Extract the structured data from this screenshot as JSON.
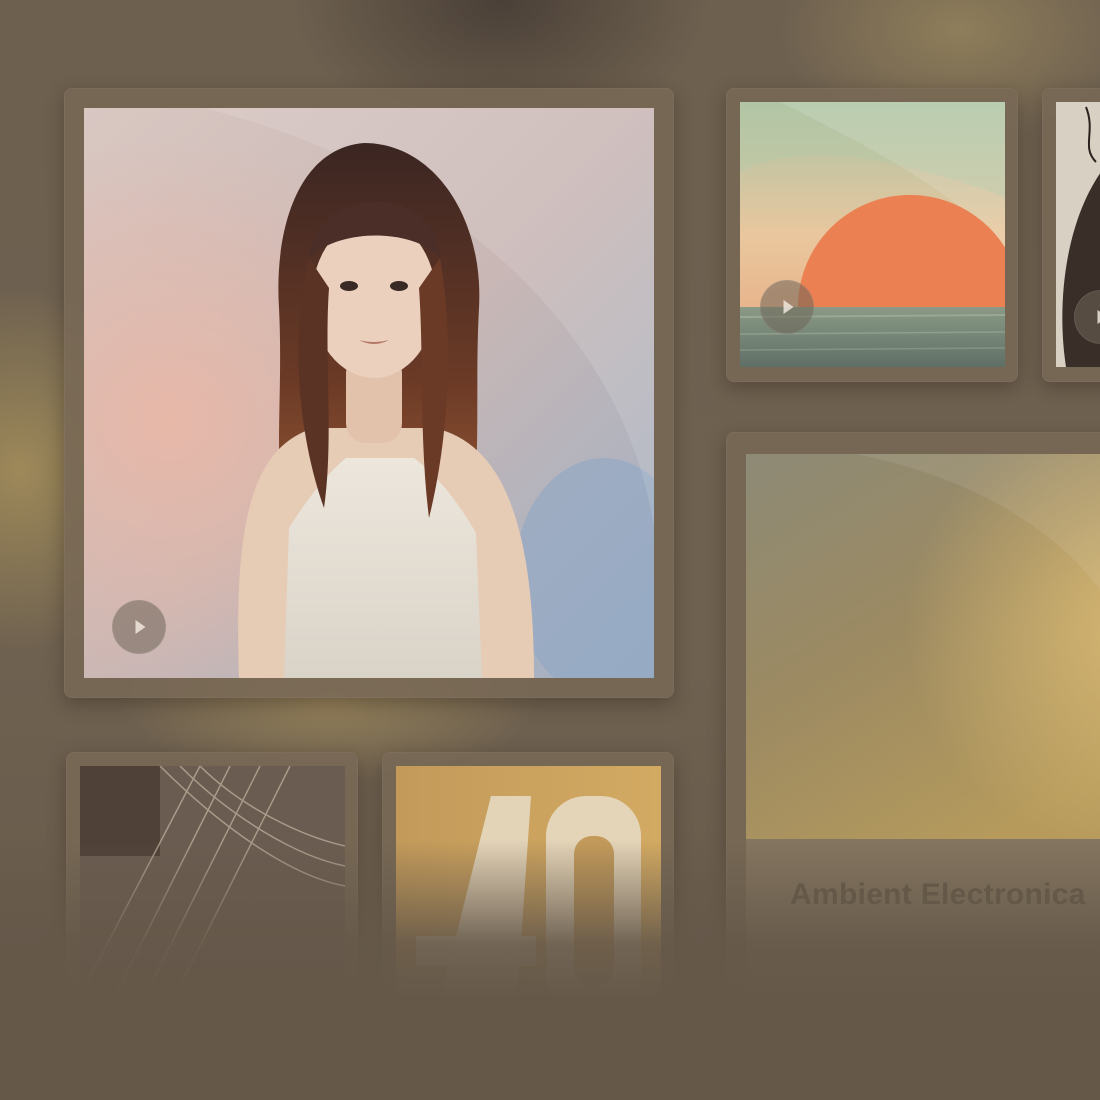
{
  "gallery": {
    "featured": {
      "play_icon": "play-icon"
    },
    "albums": [
      {
        "play_icon": "play-icon"
      },
      {
        "play_icon": "play-icon"
      }
    ],
    "playlist_card": {
      "title": "Ambient Electronica"
    }
  },
  "colors": {
    "background": "#6a5d4d",
    "tile": "#786856",
    "accent_glow": "#c4aa60"
  }
}
